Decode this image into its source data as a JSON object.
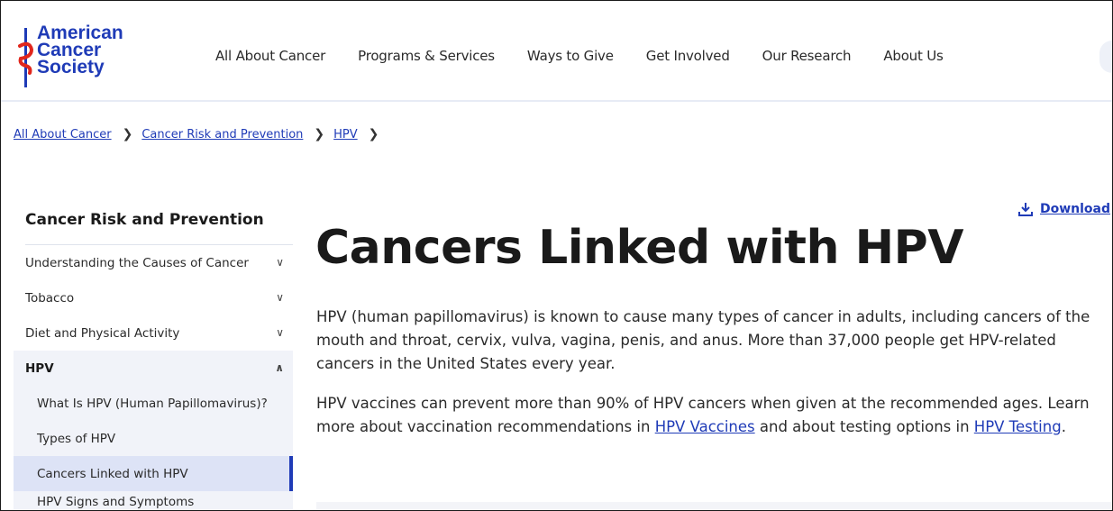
{
  "header": {
    "logo_lines": [
      "American",
      "Cancer",
      "Society"
    ],
    "nav": [
      "All About Cancer",
      "Programs & Services",
      "Ways to Give",
      "Get Involved",
      "Our Research",
      "About Us"
    ]
  },
  "breadcrumb": [
    "All About Cancer",
    "Cancer Risk and Prevention",
    "HPV"
  ],
  "sidebar": {
    "heading": "Cancer Risk and Prevention",
    "items": [
      {
        "label": "Understanding the Causes of Cancer"
      },
      {
        "label": "Tobacco"
      },
      {
        "label": "Diet and Physical Activity"
      },
      {
        "label": "HPV"
      }
    ],
    "sub_items": [
      {
        "label": "What Is HPV (Human Papillomavirus)?"
      },
      {
        "label": "Types of HPV"
      },
      {
        "label": "Cancers Linked with HPV"
      },
      {
        "label": "HPV Signs and Symptoms"
      }
    ]
  },
  "main": {
    "download_label": "Download",
    "title": "Cancers Linked with HPV",
    "paragraph1": "HPV (human papillomavirus) is known to cause many types of cancer in adults, including cancers of the mouth and throat, cervix, vulva, vagina, penis, and anus. More than 37,000 people get HPV-related cancers in the United States every year.",
    "paragraph2_before": "HPV vaccines can prevent more than 90% of HPV cancers when given at the recommended ages. Learn more about vaccination recommendations in ",
    "link_vaccines": "HPV Vaccines",
    "paragraph2_middle": " and about testing options in ",
    "link_testing": "HPV Testing",
    "paragraph2_end": "."
  },
  "colors": {
    "brand_blue": "#1f3bb7",
    "sidebar_bg": "#f1f3f9",
    "active_bg": "#dde3f6"
  }
}
